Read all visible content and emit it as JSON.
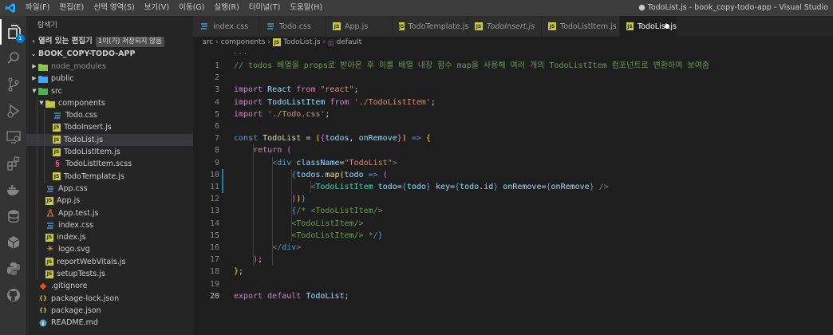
{
  "titlebar": {
    "menu": [
      "파일(F)",
      "편집(E)",
      "선택 영역(S)",
      "보기(V)",
      "이동(G)",
      "실행(R)",
      "터미널(T)",
      "도움말(H)"
    ],
    "window_title": "● TodoList.js - book_copy-todo-app - Visual Studio"
  },
  "activity": {
    "items": [
      "explorer-icon",
      "search-icon",
      "source-control-icon",
      "run-debug-icon",
      "remote-explorer-icon",
      "extensions-icon",
      "docker-icon",
      "database-icon",
      "package-icon",
      "python-icon",
      "github-icon"
    ],
    "badge": "1"
  },
  "sidebar": {
    "title": "탐색기",
    "open_editors": {
      "label": "열려 있는 편집기",
      "tag": "1이(가) 저장되지 않음"
    },
    "project": "BOOK_COPY-TODO-APP",
    "tree": [
      {
        "label": "node_modules",
        "depth": 1,
        "type": "folder",
        "expanded": false,
        "icon": "node-folder-icon",
        "dim": true
      },
      {
        "label": "public",
        "depth": 1,
        "type": "folder",
        "expanded": false,
        "icon": "public-folder-icon"
      },
      {
        "label": "src",
        "depth": 1,
        "type": "folder",
        "expanded": true,
        "icon": "src-folder-icon"
      },
      {
        "label": "components",
        "depth": 2,
        "type": "folder",
        "expanded": true,
        "icon": "components-folder-icon"
      },
      {
        "label": "Todo.css",
        "depth": 3,
        "type": "css"
      },
      {
        "label": "TodoInsert.js",
        "depth": 3,
        "type": "js"
      },
      {
        "label": "TodoList.js",
        "depth": 3,
        "type": "js",
        "selected": true
      },
      {
        "label": "TodoListItem.js",
        "depth": 3,
        "type": "js"
      },
      {
        "label": "TodoListItem.scss",
        "depth": 3,
        "type": "scss"
      },
      {
        "label": "TodoTemplate.js",
        "depth": 3,
        "type": "js"
      },
      {
        "label": "App.css",
        "depth": 2,
        "type": "css"
      },
      {
        "label": "App.js",
        "depth": 2,
        "type": "js"
      },
      {
        "label": "App.test.js",
        "depth": 2,
        "type": "test"
      },
      {
        "label": "index.css",
        "depth": 2,
        "type": "css"
      },
      {
        "label": "index.js",
        "depth": 2,
        "type": "js"
      },
      {
        "label": "logo.svg",
        "depth": 2,
        "type": "svg"
      },
      {
        "label": "reportWebVitals.js",
        "depth": 2,
        "type": "js"
      },
      {
        "label": "setupTests.js",
        "depth": 2,
        "type": "js"
      },
      {
        "label": ".gitignore",
        "depth": 1,
        "type": "git"
      },
      {
        "label": "package-lock.json",
        "depth": 1,
        "type": "json"
      },
      {
        "label": "package.json",
        "depth": 1,
        "type": "json"
      },
      {
        "label": "README.md",
        "depth": 1,
        "type": "info"
      }
    ]
  },
  "tabs": [
    {
      "label": "index.css",
      "type": "css"
    },
    {
      "label": "Todo.css",
      "type": "css"
    },
    {
      "label": "App.js",
      "type": "js"
    },
    {
      "label": "TodoTemplate.js",
      "type": "js"
    },
    {
      "label": "TodoInsert.js",
      "type": "js",
      "italic": true
    },
    {
      "label": "TodoListItem.js",
      "type": "js"
    },
    {
      "label": "TodoList.js",
      "type": "js",
      "active": true,
      "dirty": true
    }
  ],
  "breadcrumb": [
    "src",
    "components",
    "TodoList.js",
    "default"
  ],
  "editor": {
    "fold_marker": "...",
    "current_line": 20,
    "modified_lines": [
      10,
      11
    ],
    "lines": [
      {
        "n": 1,
        "tokens": [
          [
            "c",
            "// todos 배열을 props로 받아온 후 이를 배열 내장 함수 map을 사용해 여러 개의 TodoListItem 컴포넌트로 변환하여 보여줌"
          ]
        ]
      },
      {
        "n": 2,
        "tokens": []
      },
      {
        "n": 3,
        "tokens": [
          [
            "k",
            "import "
          ],
          [
            "v",
            "React "
          ],
          [
            "k",
            "from "
          ],
          [
            "s",
            "\"react\""
          ],
          [
            "p",
            ";"
          ]
        ]
      },
      {
        "n": 4,
        "tokens": [
          [
            "k",
            "import "
          ],
          [
            "v",
            "TodoListItem "
          ],
          [
            "k",
            "from "
          ],
          [
            "s",
            "'./TodoListItem'"
          ],
          [
            "p",
            ";"
          ]
        ]
      },
      {
        "n": 5,
        "tokens": [
          [
            "k",
            "import "
          ],
          [
            "s",
            "'./Todo.css'"
          ],
          [
            "p",
            ";"
          ]
        ]
      },
      {
        "n": 6,
        "tokens": []
      },
      {
        "n": 7,
        "tokens": [
          [
            "st",
            "const "
          ],
          [
            "f",
            "TodoList "
          ],
          [
            "p",
            "= "
          ],
          [
            "b1",
            "("
          ],
          [
            "b2",
            "{"
          ],
          [
            "v",
            "todos"
          ],
          [
            "p",
            ", "
          ],
          [
            "v",
            "onRemove"
          ],
          [
            "b2",
            "}"
          ],
          [
            "b1",
            ")"
          ],
          [
            "st",
            " => "
          ],
          [
            "b1",
            "{"
          ]
        ]
      },
      {
        "n": 8,
        "tokens": [
          [
            "p",
            "    "
          ],
          [
            "k",
            "return "
          ],
          [
            "b2",
            "("
          ]
        ]
      },
      {
        "n": 9,
        "tokens": [
          [
            "p",
            "        "
          ],
          [
            "tp",
            "<"
          ],
          [
            "h",
            "div "
          ],
          [
            "a",
            "className"
          ],
          [
            "p",
            "="
          ],
          [
            "s",
            "\"TodoList\""
          ],
          [
            "tp",
            ">"
          ]
        ]
      },
      {
        "n": 10,
        "tokens": [
          [
            "p",
            "            "
          ],
          [
            "st",
            "{"
          ],
          [
            "v",
            "todos"
          ],
          [
            "p",
            "."
          ],
          [
            "f",
            "map"
          ],
          [
            "b1",
            "("
          ],
          [
            "v",
            "todo "
          ],
          [
            "st",
            "=> "
          ],
          [
            "b2",
            "("
          ]
        ]
      },
      {
        "n": 11,
        "tokens": [
          [
            "p",
            "                "
          ],
          [
            "tp",
            "<"
          ],
          [
            "t",
            "TodoListItem "
          ],
          [
            "a",
            "todo"
          ],
          [
            "p",
            "="
          ],
          [
            "st",
            "{"
          ],
          [
            "v",
            "todo"
          ],
          [
            "st",
            "}"
          ],
          [
            "a",
            " key"
          ],
          [
            "p",
            "="
          ],
          [
            "st",
            "{"
          ],
          [
            "v",
            "todo"
          ],
          [
            "p",
            "."
          ],
          [
            "v",
            "id"
          ],
          [
            "st",
            "}"
          ],
          [
            "a",
            " onRemove"
          ],
          [
            "p",
            "="
          ],
          [
            "st",
            "{"
          ],
          [
            "v",
            "onRemove"
          ],
          [
            "st",
            "}"
          ],
          [
            "tp",
            " />"
          ]
        ]
      },
      {
        "n": 12,
        "tokens": [
          [
            "p",
            "            "
          ],
          [
            "b2",
            ")"
          ],
          [
            "b1",
            ")"
          ],
          [
            "st",
            "}"
          ]
        ]
      },
      {
        "n": 13,
        "tokens": [
          [
            "p",
            "            "
          ],
          [
            "st",
            "{"
          ],
          [
            "c",
            "/* <TodoListItem/>"
          ]
        ]
      },
      {
        "n": 14,
        "tokens": [
          [
            "c",
            "            <TodoListItem/>"
          ]
        ]
      },
      {
        "n": 15,
        "tokens": [
          [
            "c",
            "            <TodoListItem/> */"
          ],
          [
            "st",
            "}"
          ]
        ]
      },
      {
        "n": 16,
        "tokens": [
          [
            "p",
            "        "
          ],
          [
            "tp",
            "</"
          ],
          [
            "h",
            "div"
          ],
          [
            "tp",
            ">"
          ]
        ]
      },
      {
        "n": 17,
        "tokens": [
          [
            "p",
            "    "
          ],
          [
            "b2",
            ")"
          ],
          [
            "p",
            ";"
          ]
        ]
      },
      {
        "n": 18,
        "tokens": [
          [
            "b1",
            "}"
          ],
          [
            "p",
            ";"
          ]
        ]
      },
      {
        "n": 19,
        "tokens": []
      },
      {
        "n": 20,
        "tokens": [
          [
            "k",
            "export "
          ],
          [
            "k",
            "default "
          ],
          [
            "v",
            "TodoList"
          ],
          [
            "p",
            ";"
          ]
        ]
      }
    ]
  },
  "colors": {
    "css": "#519aba",
    "js": "#cbcb41",
    "scss": "#f55385",
    "svg": "#ffb13b",
    "json": "#cbcb41",
    "git": "#e44d26",
    "info": "#519aba",
    "test": "#e37933",
    "folder": "#dcb67a",
    "accent": "#007acc"
  }
}
